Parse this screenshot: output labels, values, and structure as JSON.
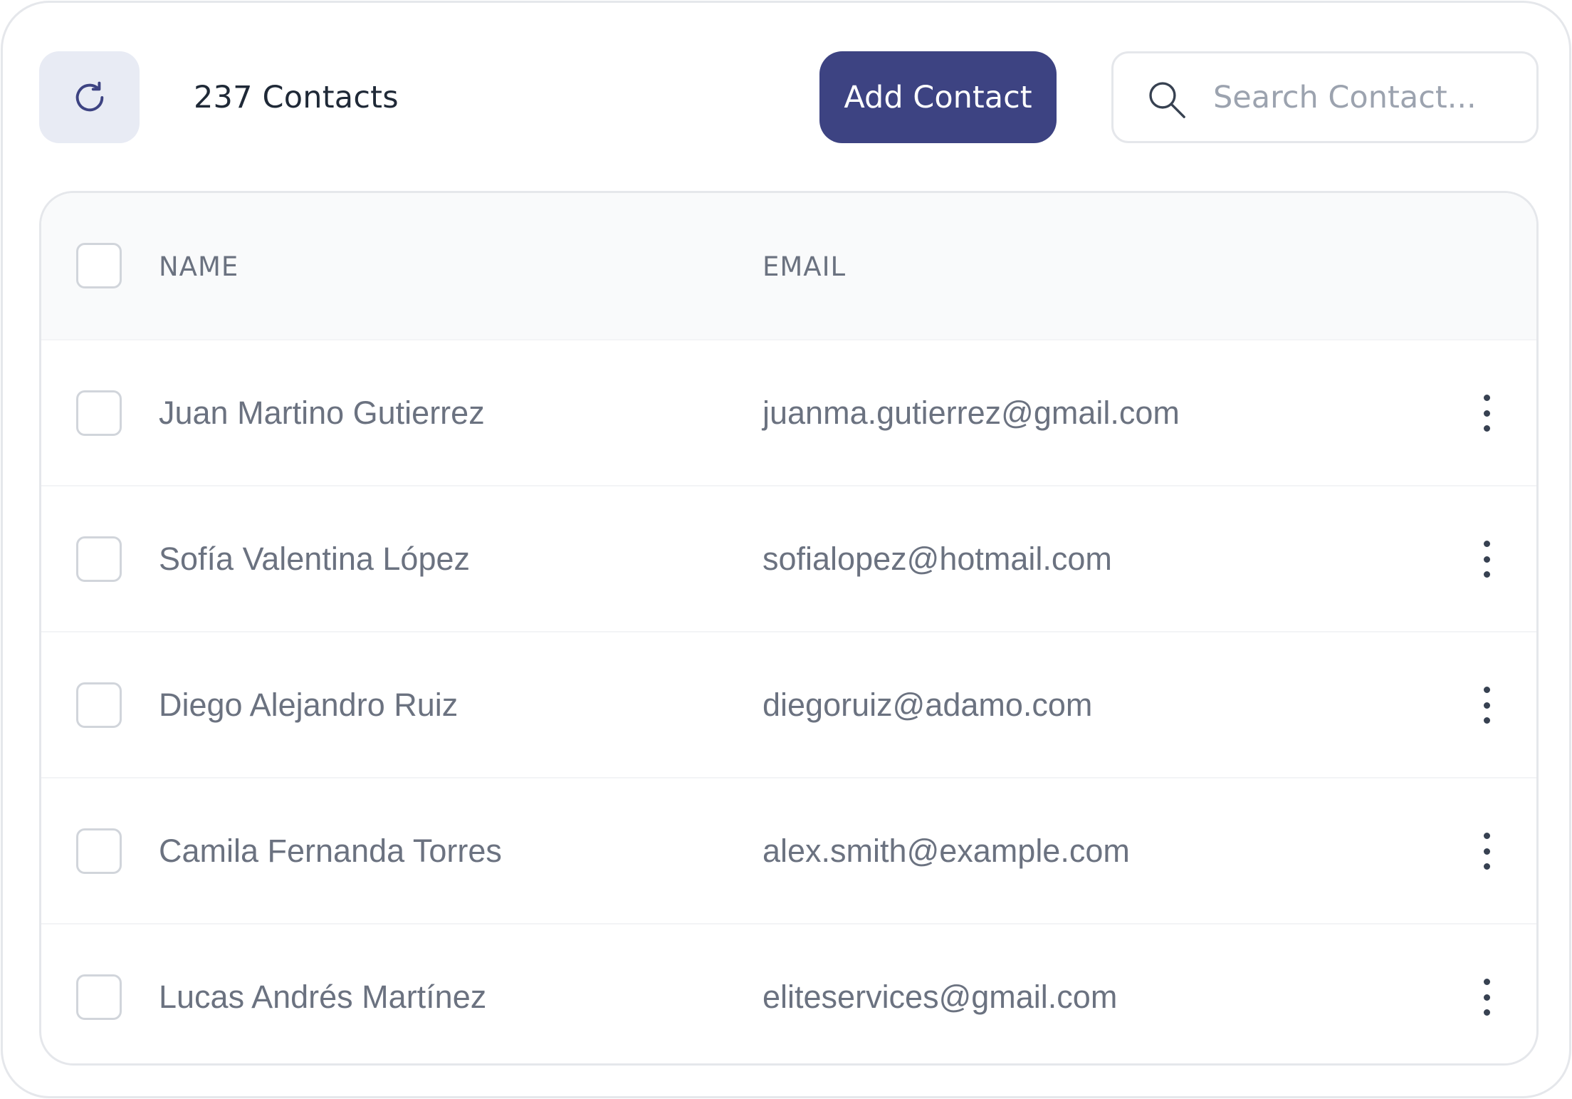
{
  "toolbar": {
    "refresh_icon": "refresh-icon",
    "contact_count": "237 Contacts",
    "add_label": "Add Contact",
    "search_icon": "search-icon",
    "search_placeholder": "Search Contact...",
    "accent_color": "#3d4382"
  },
  "table": {
    "headers": {
      "name": "NAME",
      "email": "EMAIL"
    },
    "rows": [
      {
        "name": "Juan Martino Gutierrez",
        "email": "juanma.gutierrez@gmail.com"
      },
      {
        "name": "Sofía Valentina López",
        "email": "sofialopez@hotmail.com"
      },
      {
        "name": "Diego Alejandro Ruiz",
        "email": "diegoruiz@adamo.com"
      },
      {
        "name": "Camila Fernanda Torres",
        "email": "alex.smith@example.com"
      },
      {
        "name": "Lucas Andrés Martínez",
        "email": "eliteservices@gmail.com"
      }
    ],
    "row_menu_icon": "more-vertical-icon"
  }
}
